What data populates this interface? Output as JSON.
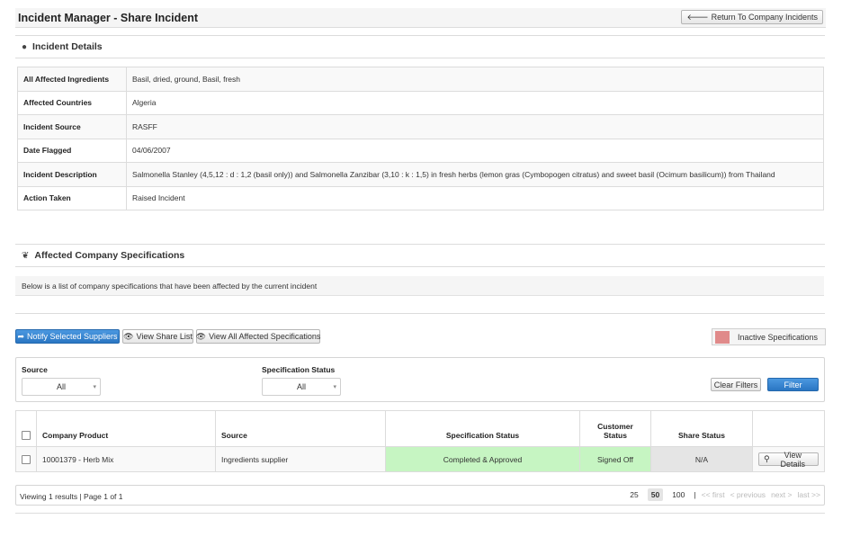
{
  "header": {
    "title": "Incident Manager - Share Incident",
    "return_label": "Return To Company Incidents"
  },
  "incident_details": {
    "heading": "Incident Details",
    "icon": "globe-icon",
    "rows": [
      {
        "label": "All Affected Ingredients",
        "value": "Basil, dried, ground, Basil, fresh"
      },
      {
        "label": "Affected Countries",
        "value": "Algeria"
      },
      {
        "label": "Incident Source",
        "value": "RASFF"
      },
      {
        "label": "Date Flagged",
        "value": "04/06/2007"
      },
      {
        "label": "Incident Description",
        "value": "Salmonella Stanley (4,5,12 : d : 1,2 (basil only)) and Salmonella Zanzibar (3,10 : k : 1,5) in fresh herbs (lemon gras (Cymbopogen citratus) and sweet basil (Ocimum basilicum)) from Thailand"
      },
      {
        "label": "Action Taken",
        "value": "Raised Incident"
      }
    ]
  },
  "affected_specs": {
    "heading": "Affected Company Specifications",
    "icon": "leaf-icon",
    "description": "Below is a list of company specifications that have been affected by the current incident"
  },
  "toolbar": {
    "notify_label": "Notify Selected Suppliers",
    "share_list_label": "View Share List",
    "view_all_label": "View All Affected Specifications",
    "legend_label": "Inactive Specifications",
    "legend_color": "#e08a8a"
  },
  "filters": {
    "source_label": "Source",
    "source_value": "All",
    "status_label": "Specification Status",
    "status_value": "All",
    "clear_label": "Clear Filters",
    "filter_label": "Filter"
  },
  "grid": {
    "columns": {
      "product": "Company Product",
      "source": "Source",
      "spec_status": "Specification Status",
      "customer_status_1": "Customer",
      "customer_status_2": "Status",
      "share_status": "Share Status"
    },
    "rows": [
      {
        "product": "10001379 - Herb Mix",
        "source": "Ingredients supplier",
        "spec_status": "Completed & Approved",
        "customer_status": "Signed Off",
        "share_status": "N/A",
        "action_label": "View Details"
      }
    ]
  },
  "pager": {
    "info": "Viewing 1 results | Page 1 of 1",
    "sizes": [
      "25",
      "50",
      "100"
    ],
    "separator": "|",
    "first": "<< first",
    "previous": "< previous",
    "next": "next >",
    "last": "last >>"
  },
  "colors": {
    "primary": "#2a76c3",
    "approved": "#c6f5c2",
    "na": "#e5e5e5"
  }
}
